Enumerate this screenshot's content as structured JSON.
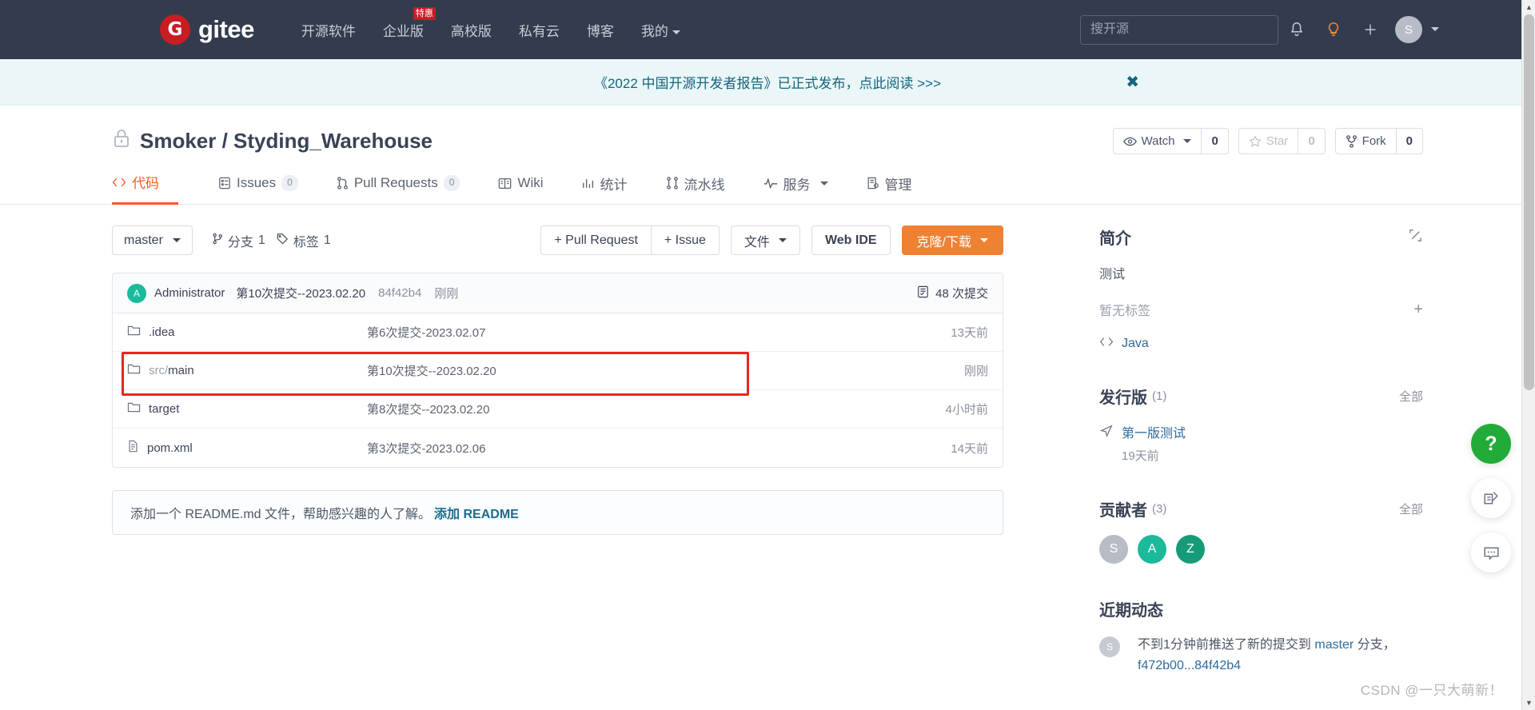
{
  "topnav": {
    "logo_letter": "G",
    "logo_text": "gitee",
    "links": [
      {
        "label": "开源软件",
        "badge": ""
      },
      {
        "label": "企业版",
        "badge": "特惠"
      },
      {
        "label": "高校版",
        "badge": ""
      },
      {
        "label": "私有云",
        "badge": ""
      },
      {
        "label": "博客",
        "badge": ""
      },
      {
        "label": "我的",
        "badge": "",
        "has_caret": true
      }
    ],
    "search_placeholder": "搜开源",
    "avatar_letter": "S"
  },
  "banner": {
    "text": "《2022 中国开源开发者报告》已正式发布，点此阅读 >>>",
    "close": "✖"
  },
  "repo": {
    "owner": "Smoker",
    "separator": "/",
    "name": "Styding_Warehouse",
    "full_title": "Smoker / Styding_Warehouse",
    "watch_label": "Watch",
    "watch_count": "0",
    "star_label": "Star",
    "star_count": "0",
    "fork_label": "Fork",
    "fork_count": "0"
  },
  "tabs": [
    {
      "label": "代码",
      "count": "",
      "active": true
    },
    {
      "label": "Issues",
      "count": "0",
      "active": false
    },
    {
      "label": "Pull Requests",
      "count": "0",
      "active": false
    },
    {
      "label": "Wiki",
      "count": "",
      "active": false
    },
    {
      "label": "统计",
      "count": "",
      "active": false
    },
    {
      "label": "流水线",
      "count": "",
      "active": false
    },
    {
      "label": "服务",
      "count": "",
      "active": false,
      "has_caret": true
    },
    {
      "label": "管理",
      "count": "",
      "active": false
    }
  ],
  "toolbar": {
    "branch": "master",
    "branches_label": "分支",
    "branches_count": "1",
    "tags_label": "标签",
    "tags_count": "1",
    "pull_request_btn": "+ Pull Request",
    "issue_btn": "+ Issue",
    "files_btn": "文件",
    "webide_btn": "Web IDE",
    "clone_btn": "克隆/下载"
  },
  "commit_bar": {
    "avatar_letter": "A",
    "author": "Administrator",
    "message": "第10次提交--2023.02.20",
    "sha": "84f42b4",
    "time": "刚刚",
    "commits_count_label": "48 次提交"
  },
  "files": [
    {
      "icon": "folder-icon",
      "name": "",
      "name_dim": "",
      "name_plain": ".idea",
      "message": "第6次提交-2023.02.07",
      "time": "13天前",
      "highlighted": false
    },
    {
      "icon": "folder-icon",
      "name_dim": "src/",
      "name_plain": "main",
      "message": "第10次提交--2023.02.20",
      "time": "刚刚",
      "highlighted": true
    },
    {
      "icon": "folder-icon",
      "name_dim": "",
      "name_plain": "target",
      "message": "第8次提交--2023.02.20",
      "time": "4小时前",
      "highlighted": false
    },
    {
      "icon": "file-icon",
      "name_dim": "",
      "name_plain": "pom.xml",
      "message": "第3次提交-2023.02.06",
      "time": "14天前",
      "highlighted": false
    }
  ],
  "readme_notice": {
    "text": "添加一个 README.md 文件，帮助感兴趣的人了解。",
    "link": "添加 README"
  },
  "sidebar": {
    "intro_title": "简介",
    "intro_edit_icon": "edit-icon",
    "intro_text": "测试",
    "tags_text": "暂无标签",
    "tags_add": "+",
    "language": "Java",
    "releases_title": "发行版",
    "releases_count": "(1)",
    "releases_all": "全部",
    "release_name": "第一版测试",
    "release_time": "19天前",
    "contributors_title": "贡献者",
    "contributors_count": "(3)",
    "contributors_all": "全部",
    "contributors": [
      {
        "letter": "S",
        "color": "#b7bcc6"
      },
      {
        "letter": "A",
        "color": "#1aba9b"
      },
      {
        "letter": "Z",
        "color": "#159b78"
      }
    ],
    "activity_title": "近期动态",
    "activity_avatar": "S",
    "activity_prefix": "不到1分钟前推送了新的提交到 ",
    "activity_branch": "master",
    "activity_suffix": " 分支，",
    "activity_sha": "f472b00...84f42b4"
  },
  "floaters": [
    {
      "name": "help-fab",
      "glyph": "?",
      "style": "green"
    },
    {
      "name": "feedback-fab",
      "glyph": "edit",
      "style": "white"
    },
    {
      "name": "chat-fab",
      "glyph": "chat",
      "style": "white"
    }
  ],
  "watermark": "CSDN @一只大萌新！"
}
